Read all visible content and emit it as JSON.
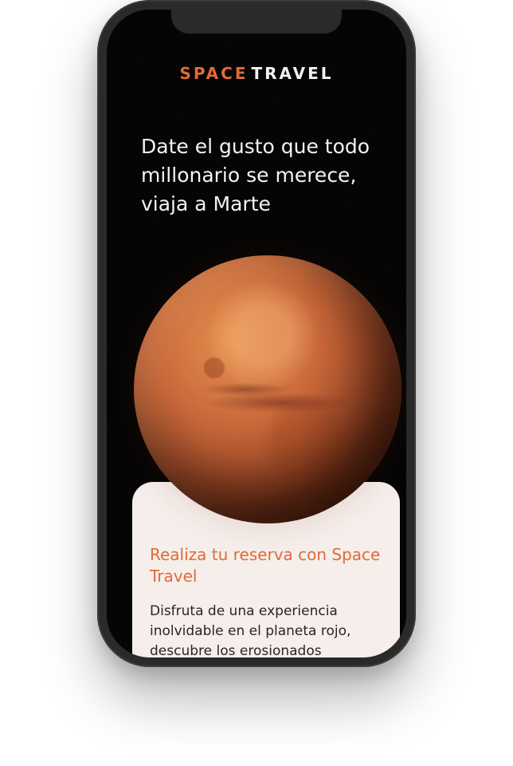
{
  "brand": {
    "word1": "SPACE",
    "word2": "TRAVEL",
    "accent_color": "#e06b37"
  },
  "hero": {
    "headline": "Date el gusto que todo millonario se merece, viaja a Marte",
    "image": "mars-planet"
  },
  "card": {
    "title": "Realiza tu reserva con Space Travel",
    "text": "Disfruta de una experiencia inolvidable en el planeta rojo, descubre los erosionados"
  }
}
